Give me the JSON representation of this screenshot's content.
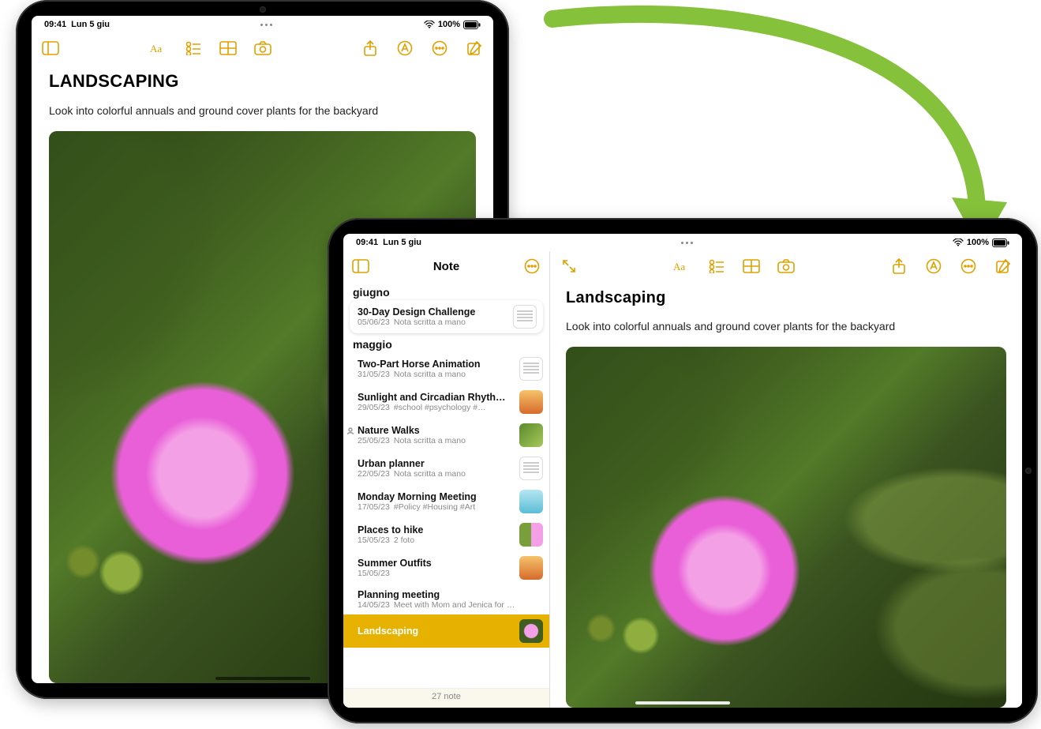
{
  "status": {
    "time": "09:41",
    "date": "Lun 5 giu",
    "battery_pct": "100%"
  },
  "portrait_note": {
    "title": "LANDSCAPING",
    "body": "Look into colorful annuals and ground cover plants for the backyard"
  },
  "landscape": {
    "sidebar": {
      "title": "Note",
      "sections": [
        {
          "label": "giugno",
          "items": [
            {
              "title": "30-Day Design Challenge",
              "date": "05/06/23",
              "desc": "Nota scritta a mano",
              "thumb": "doc",
              "featured": true
            }
          ]
        },
        {
          "label": "maggio",
          "items": [
            {
              "title": "Two-Part Horse Animation",
              "date": "31/05/23",
              "desc": "Nota scritta a mano",
              "thumb": "doc"
            },
            {
              "title": "Sunlight and Circadian Rhyth…",
              "date": "29/05/23",
              "desc": "#school #psychology #…",
              "thumb": "orange"
            },
            {
              "title": "Nature Walks",
              "date": "25/05/23",
              "desc": "Nota scritta a mano",
              "thumb": "green2",
              "shared": true
            },
            {
              "title": "Urban planner",
              "date": "22/05/23",
              "desc": "Nota scritta a mano",
              "thumb": "doc"
            },
            {
              "title": "Monday Morning Meeting",
              "date": "17/05/23",
              "desc": "#Policy #Housing #Art",
              "thumb": "blue"
            },
            {
              "title": "Places to hike",
              "date": "15/05/23",
              "desc": "2 foto",
              "thumb": "pair"
            },
            {
              "title": "Summer Outfits",
              "date": "15/05/23",
              "desc": "",
              "thumb": "orange"
            },
            {
              "title": "Planning meeting",
              "date": "14/05/23",
              "desc": "Meet with Mom and Jenica for …",
              "thumb": "",
              "nothumb": true
            },
            {
              "title": "Landscaping",
              "date": "",
              "desc": "",
              "thumb": "pink",
              "selected": true
            }
          ]
        }
      ],
      "footer": "27 note"
    },
    "note": {
      "title": "Landscaping",
      "body": "Look into colorful annuals and ground cover plants for the backyard"
    }
  }
}
